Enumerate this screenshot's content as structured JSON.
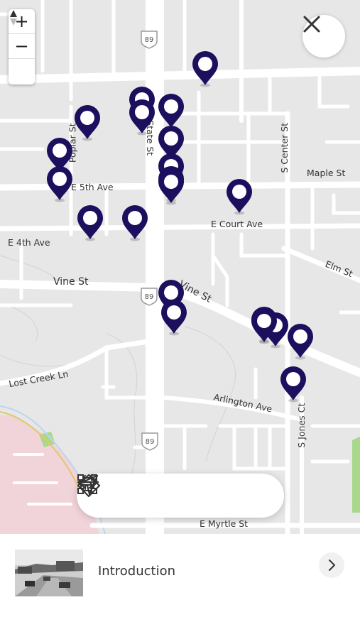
{
  "map": {
    "background": "#e7e7e7",
    "road_color": "#ffffff",
    "pin_color": "#1c0f5e",
    "labels": {
      "state_st": "State St",
      "poplar_st": "Poplar St",
      "s_center_st": "S Center St",
      "maple_st": "Maple St",
      "e_5th_ave": "E 5th Ave",
      "e_court_ave": "E Court Ave",
      "e_4th_ave": "E 4th Ave",
      "elm_st": "Elm St",
      "vine_st": "Vine St",
      "vine_st_diag": "Vine St",
      "lost_creek_ln": "Lost Creek Ln",
      "arlington_ave": "Arlington Ave",
      "s_jones_ct": "S Jones Ct",
      "e_myrtle_st": "E Myrtle St"
    },
    "route_shields": [
      "89",
      "89",
      "89"
    ],
    "pin_count": 21
  },
  "zoom": {
    "in": "+",
    "out": "−"
  },
  "toolbar": {
    "icons": [
      "arrow-left-icon",
      "bounding-box-icon",
      "navigate-icon",
      "directions-icon",
      "arrow-right-icon"
    ]
  },
  "bottom": {
    "title": "Introduction"
  }
}
